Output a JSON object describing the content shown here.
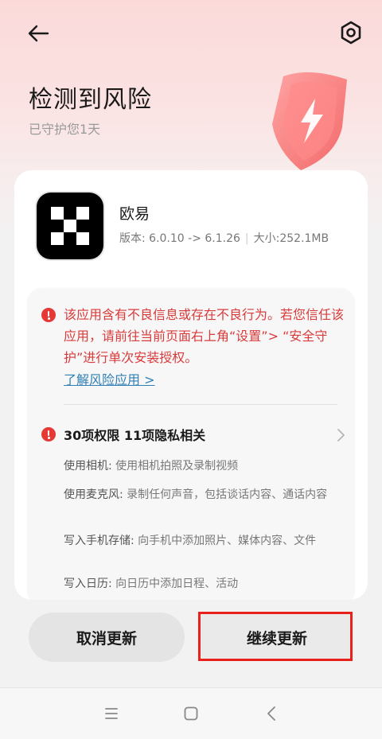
{
  "header": {
    "title": "检测到风险",
    "subtitle": "已守护您1天"
  },
  "app": {
    "name": "欧易",
    "version": "版本: 6.0.10 -> 6.1.26",
    "size": "大小:252.1MB"
  },
  "warning": {
    "text": "该应用含有不良信息或存在不良行为。若您信任该应用，请前往当前页面右上角“设置”> “安全守护”进行单次安装授权。",
    "link": "了解风险应用 >"
  },
  "permissions": {
    "title": "30项权限 11项隐私相关",
    "items": [
      {
        "label": "使用相机:",
        "desc": "使用相机拍照及录制视频"
      },
      {
        "label": "使用麦克风:",
        "desc": "录制任何声音，包括谈话内容、通话内容"
      },
      {
        "label": "写入手机存储:",
        "desc": "向手机中添加照片、媒体内容、文件"
      },
      {
        "label": "写入日历:",
        "desc": "向日历中添加日程、活动"
      }
    ]
  },
  "buttons": {
    "cancel": "取消更新",
    "continue": "继续更新"
  },
  "colors": {
    "danger": "#e53935",
    "link": "#2f7fb5",
    "highlight": "#e8221b"
  },
  "icons": [
    "back-arrow-icon",
    "settings-gear-icon",
    "shield-lightning-icon",
    "warning-icon",
    "chevron-right-icon",
    "menu-icon",
    "home-icon",
    "nav-back-icon"
  ]
}
